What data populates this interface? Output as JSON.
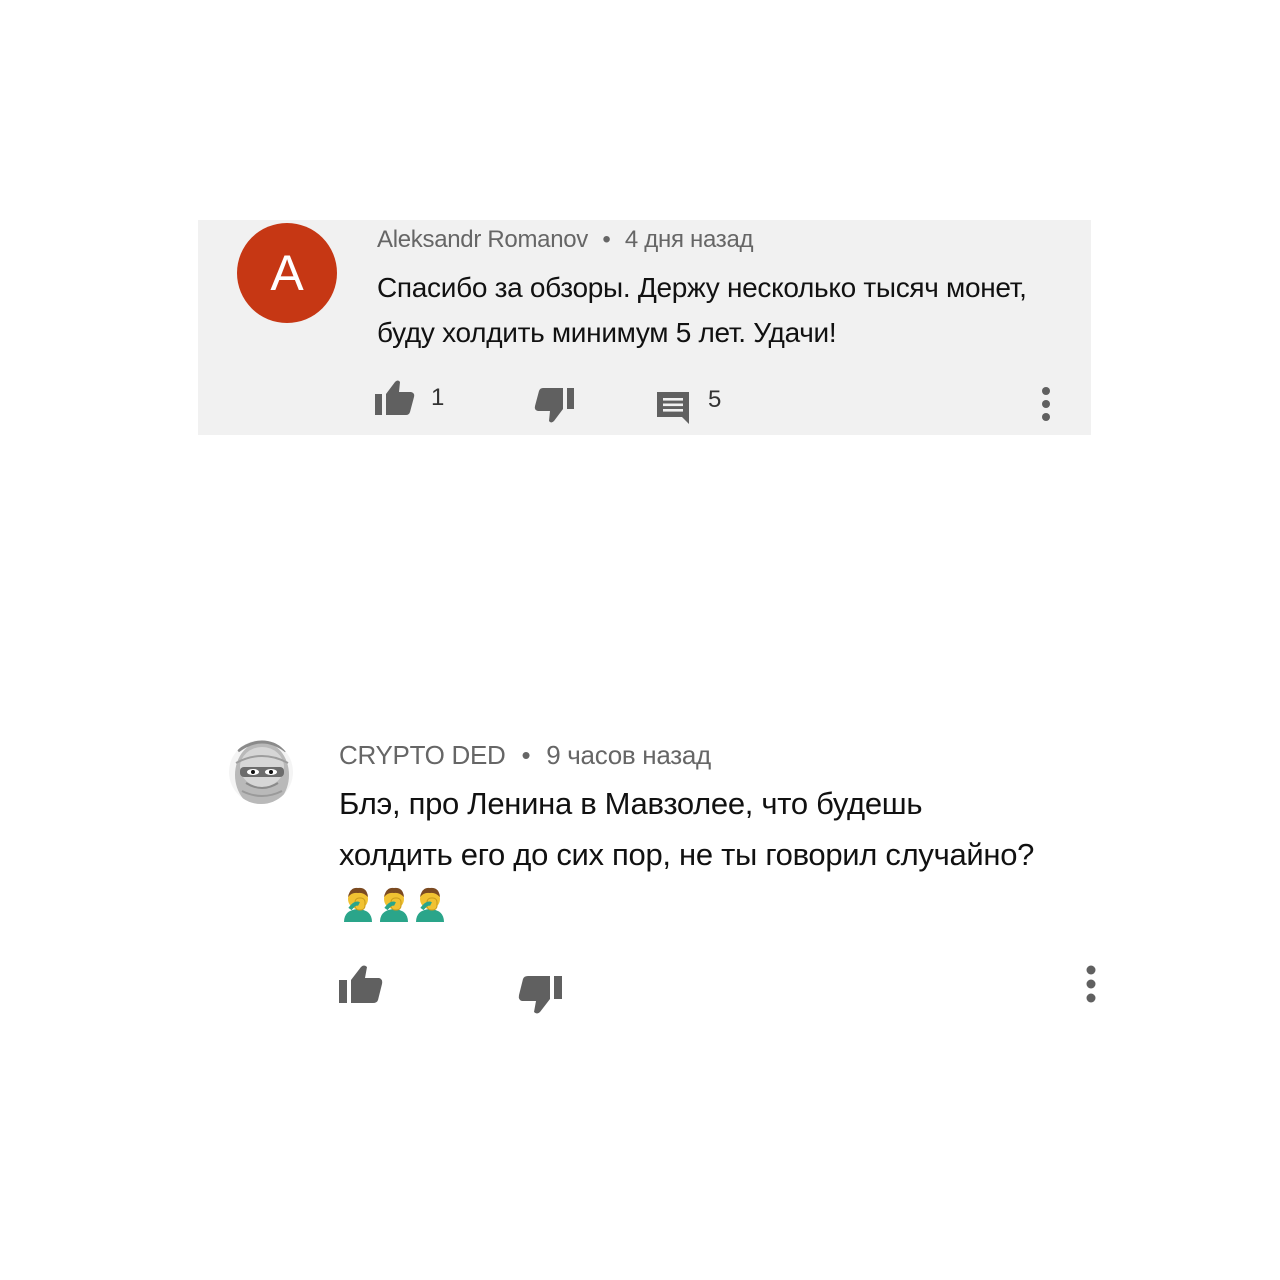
{
  "comments": [
    {
      "author": "Aleksandr Romanov",
      "separator": "•",
      "time": "4 дня назад",
      "avatar_letter": "A",
      "avatar_color": "#c63714",
      "text": "Спасибо за обзоры. Держу несколько тысяч монет, буду холдить минимум 5 лет. Удачи!",
      "likes": "1",
      "replies": "5",
      "background": "#f1f1f1"
    },
    {
      "author": "CRYPTO DED",
      "separator": "•",
      "time": "9 часов назад",
      "avatar_icon": "masked-man-avatar",
      "text": "Блэ, про Ленина в Мавзолее, что будешь холдить его до сих пор, не ты говорил случайно?",
      "emoji": "facepalm-emoji",
      "emoji_count": 3
    }
  ],
  "icons": {
    "like": "thumbs-up-icon",
    "dislike": "thumbs-down-icon",
    "reply": "comment-icon",
    "menu": "more-vert-icon"
  },
  "colors": {
    "icon": "#606060",
    "meta_text": "#666666",
    "body_text": "#111111"
  }
}
